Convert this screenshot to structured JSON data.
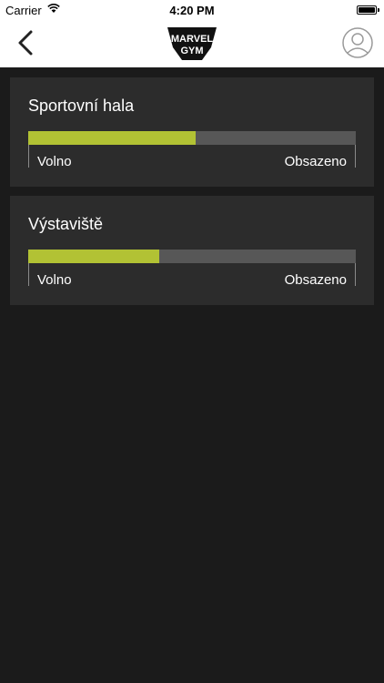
{
  "status_bar": {
    "carrier": "Carrier",
    "time": "4:20 PM"
  },
  "nav": {
    "back_icon": "chevron-left-icon",
    "logo": "MARVEL GYM",
    "profile_icon": "user-avatar-icon"
  },
  "colors": {
    "accent": "#b2c234",
    "track": "#575757",
    "card": "#2c2c2c",
    "background": "#1b1b1b"
  },
  "occupancy": [
    {
      "name": "Sportovní hala",
      "level_fraction": 0.51,
      "label_low": "Volno",
      "label_high": "Obsazeno"
    },
    {
      "name": "Výstaviště",
      "level_fraction": 0.4,
      "label_low": "Volno",
      "label_high": "Obsazeno"
    }
  ]
}
